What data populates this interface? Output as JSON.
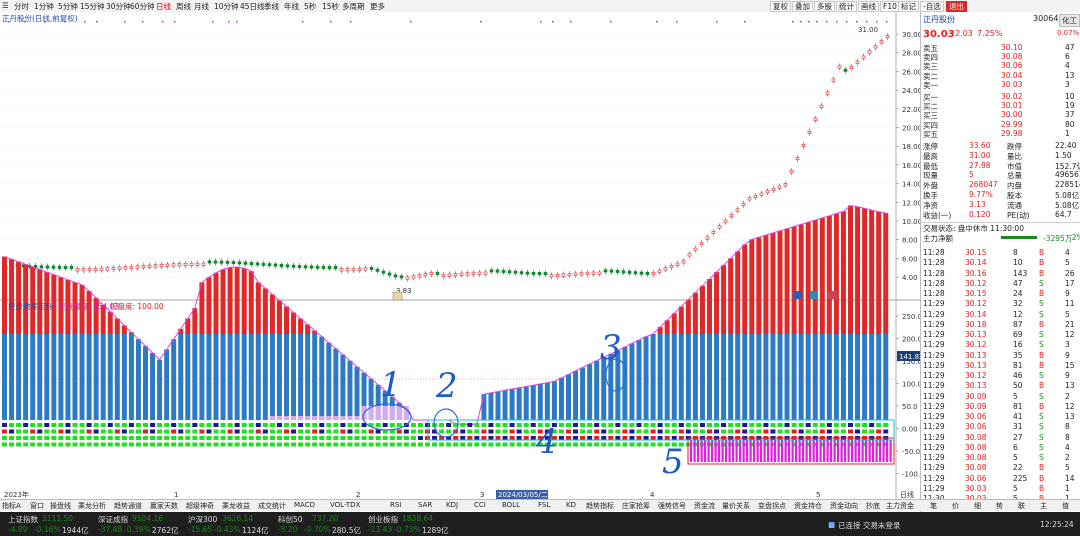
{
  "toolbar": {
    "left_tabs": [
      "分时",
      "1分钟",
      "5分钟",
      "15分钟",
      "30分钟",
      "60分钟",
      "日线",
      "周线",
      "月线",
      "10分钟",
      "45日线",
      "季线",
      "年线",
      "5秒",
      "15秒",
      "多周期",
      "更多"
    ],
    "active_tab": "日线",
    "right_buttons": [
      "复权",
      "叠加",
      "多股",
      "统计",
      "画线",
      "F10",
      "标记",
      "-自选",
      "退出"
    ]
  },
  "chart": {
    "title": "正丹股份(日线,前复权)",
    "high_label": "31.00",
    "low_label": "3.83",
    "indicator_label": "控盘抛筹走升",
    "indicator_v1": "控盘强度: 254.03",
    "indicator_v2": "控盘度: 100.00",
    "marker_line_label": "141.83",
    "price_axis": [
      "30.00",
      "28.00",
      "26.00",
      "24.00",
      "22.00",
      "20.00",
      "18.00",
      "16.00",
      "14.00",
      "12.00",
      "10.00",
      "8.00",
      "6.00",
      "4.00"
    ],
    "indicator_axis": [
      "250.0",
      "200.0",
      "150.0",
      "100.0",
      "50.0",
      "0.00",
      "-50.0",
      "-100.0"
    ],
    "dates": [
      "2023年",
      "1",
      "2",
      "3",
      "2024/03/05/二",
      "4",
      "5",
      "日线"
    ]
  },
  "annotations": [
    "1",
    "2",
    "3",
    "4",
    "5"
  ],
  "bottom_tabs": [
    "指标A",
    "窗口",
    "操盘线",
    "乘龙分析",
    "趋势通道",
    "赢家天数",
    "超级神奇",
    "乘龙收益",
    "成交统计",
    "MACD",
    "VOL-TDX",
    "RSI",
    "SAR",
    "KDJ",
    "CCI",
    "BOLL",
    "FSL",
    "KD",
    "趋势指标",
    "庄家抢筹",
    "强势信号",
    "资金流",
    "量价关系",
    "变盘拐点",
    "资金持仓",
    "资金动向",
    "抄底",
    "主力资金",
    "指标B",
    "模板",
    "+"
  ],
  "quote": {
    "name": "正丹股份",
    "code": "300641",
    "badge": "化工",
    "price": "30.03",
    "change": "2.03",
    "change_pct": "7.25%",
    "weibi": "0.07%",
    "asks": [
      {
        "label": "卖五",
        "price": "30.10",
        "vol": "47"
      },
      {
        "label": "卖四",
        "price": "30.08",
        "vol": "6"
      },
      {
        "label": "卖三",
        "price": "30.06",
        "vol": "4"
      },
      {
        "label": "卖二",
        "price": "30.04",
        "vol": "13"
      },
      {
        "label": "卖一",
        "price": "30.03",
        "vol": "3"
      }
    ],
    "bids": [
      {
        "label": "买一",
        "price": "30.02",
        "vol": "10"
      },
      {
        "label": "买二",
        "price": "30.01",
        "vol": "19"
      },
      {
        "label": "买三",
        "price": "30.00",
        "vol": "37"
      },
      {
        "label": "买四",
        "price": "29.99",
        "vol": "80"
      },
      {
        "label": "买五",
        "price": "29.98",
        "vol": "1"
      }
    ],
    "stats": [
      [
        "涨停",
        "33.60",
        "跌停",
        "22.40"
      ],
      [
        "最高",
        "31.00",
        "量比",
        "1.50"
      ],
      [
        "最低",
        "27.88",
        "市值",
        "152.7亿"
      ],
      [
        "现量",
        "5",
        "总量",
        "496561"
      ],
      [
        "外盘",
        "268047",
        "内盘",
        "228514"
      ],
      [
        "换手",
        "9.77%",
        "股本",
        "5.08亿"
      ],
      [
        "净资",
        "3.13",
        "流通",
        "5.08亿"
      ],
      [
        "收益(一)",
        "0.120",
        "PE(动)",
        "64.7"
      ]
    ],
    "trade_status": "交易状态: 盘中休市 11:30:00",
    "main_flow": "主力净额",
    "main_flow_val": "-3295万",
    "main_flow_pct": "-2%",
    "ticks": [
      [
        "11:28",
        "30.15",
        "8",
        "B",
        "4"
      ],
      [
        "11:28",
        "30.14",
        "10",
        "B",
        "5"
      ],
      [
        "11:28",
        "30.16",
        "143",
        "B",
        "26"
      ],
      [
        "11:28",
        "30.12",
        "47",
        "S",
        "17"
      ],
      [
        "11:28",
        "30.15",
        "24",
        "B",
        "9"
      ],
      [
        "11:29",
        "30.12",
        "32",
        "S",
        "11"
      ],
      [
        "11:29",
        "30.14",
        "12",
        "S",
        "5"
      ],
      [
        "11:29",
        "30.18",
        "87",
        "B",
        "21"
      ],
      [
        "11:29",
        "30.13",
        "69",
        "S",
        "12"
      ],
      [
        "11:29",
        "30.12",
        "16",
        "S",
        "3"
      ],
      [
        "11:29",
        "30.13",
        "35",
        "B",
        "9"
      ],
      [
        "11:29",
        "30.13",
        "81",
        "B",
        "15"
      ],
      [
        "11:29",
        "30.12",
        "46",
        "S",
        "9"
      ],
      [
        "11:29",
        "30.13",
        "50",
        "B",
        "13"
      ],
      [
        "11:29",
        "30.09",
        "5",
        "S",
        "2"
      ],
      [
        "11:29",
        "30.09",
        "81",
        "B",
        "12"
      ],
      [
        "11:29",
        "30.06",
        "41",
        "S",
        "13"
      ],
      [
        "11:29",
        "30.06",
        "31",
        "S",
        "8"
      ],
      [
        "11:29",
        "30.08",
        "27",
        "S",
        "8"
      ],
      [
        "11:29",
        "30.08",
        "6",
        "S",
        "4"
      ],
      [
        "11:29",
        "30.08",
        "5",
        "S",
        "2"
      ],
      [
        "11:29",
        "30.08",
        "22",
        "B",
        "5"
      ],
      [
        "11:29",
        "30.06",
        "225",
        "B",
        "14"
      ],
      [
        "11:29",
        "30.03",
        "5",
        "B",
        "1"
      ],
      [
        "11:30",
        "30.03",
        "5",
        "B",
        "1"
      ]
    ],
    "right_tabs": [
      "笔",
      "价",
      "细",
      "势",
      "联",
      "主",
      "值"
    ]
  },
  "status": {
    "indices": [
      {
        "name": "上证指数",
        "value": "3111.50",
        "chg": "-4.89",
        "pct": "-0.16%",
        "amt": "1944亿"
      },
      {
        "name": "深证成指",
        "value": "9504.16",
        "chg": "-37.48",
        "pct": "-0.39%",
        "amt": "2762亿"
      },
      {
        "name": "沪深300",
        "value": "3626.14",
        "chg": "-15.65",
        "pct": "-0.43%",
        "amt": "1124亿"
      },
      {
        "name": "科创50",
        "value": "737.20",
        "chg": "-5.20",
        "pct": "-0.70%",
        "amt": "280.5亿"
      },
      {
        "name": "创业板指",
        "value": "1838.64",
        "chg": "-13.43",
        "pct": "-0.73%",
        "amt": "1289亿"
      }
    ],
    "connection": "已连接 交易未登录",
    "time": "12:25:24"
  }
}
